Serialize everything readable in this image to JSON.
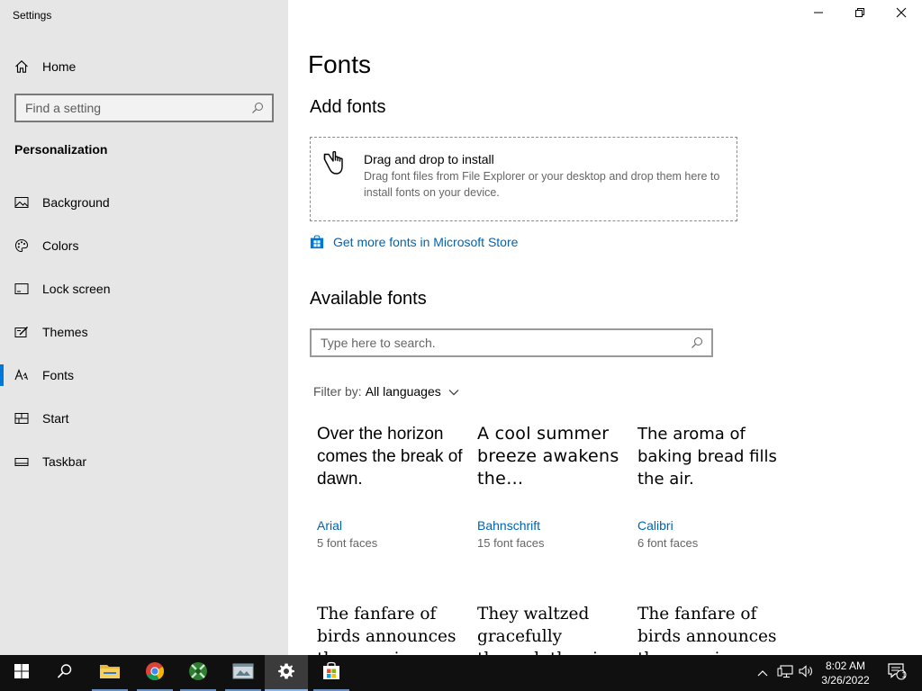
{
  "window": {
    "title": "Settings"
  },
  "sidebar": {
    "home_label": "Home",
    "search_placeholder": "Find a setting",
    "section": "Personalization",
    "items": [
      {
        "label": "Background"
      },
      {
        "label": "Colors"
      },
      {
        "label": "Lock screen"
      },
      {
        "label": "Themes"
      },
      {
        "label": "Fonts"
      },
      {
        "label": "Start"
      },
      {
        "label": "Taskbar"
      }
    ],
    "active_item": "Fonts"
  },
  "main": {
    "title": "Fonts",
    "add_heading": "Add fonts",
    "dropzone": {
      "title": "Drag and drop to install",
      "description": "Drag font files from File Explorer or your desktop and drop them here to install fonts on your device."
    },
    "store_link": "Get more fonts in Microsoft Store",
    "available_heading": "Available fonts",
    "search_placeholder": "Type here to search.",
    "filter_label": "Filter by:",
    "filter_value": "All languages",
    "fonts": [
      {
        "sample": "Over the horizon comes the break of dawn.",
        "name": "Arial",
        "faces": "5 font faces"
      },
      {
        "sample": "A cool summer breeze awakens the…",
        "name": "Bahnschrift",
        "faces": "15 font faces"
      },
      {
        "sample": "The aroma of baking bread fills the air.",
        "name": "Calibri",
        "faces": "6 font faces"
      },
      {
        "sample": "The fanfare of birds announces the morning.",
        "name": "",
        "faces": ""
      },
      {
        "sample": "They waltzed gracefully through the air.",
        "name": "",
        "faces": ""
      },
      {
        "sample": "The fanfare of birds announces the morning.",
        "name": "",
        "faces": ""
      }
    ]
  },
  "taskbar": {
    "time": "8:02 AM",
    "date": "3/26/2022",
    "notification_count": "1"
  },
  "colors": {
    "accent": "#0078d7",
    "link": "#0063b1",
    "sidebar_bg": "#e6e6e6",
    "taskbar_bg": "#101010"
  }
}
